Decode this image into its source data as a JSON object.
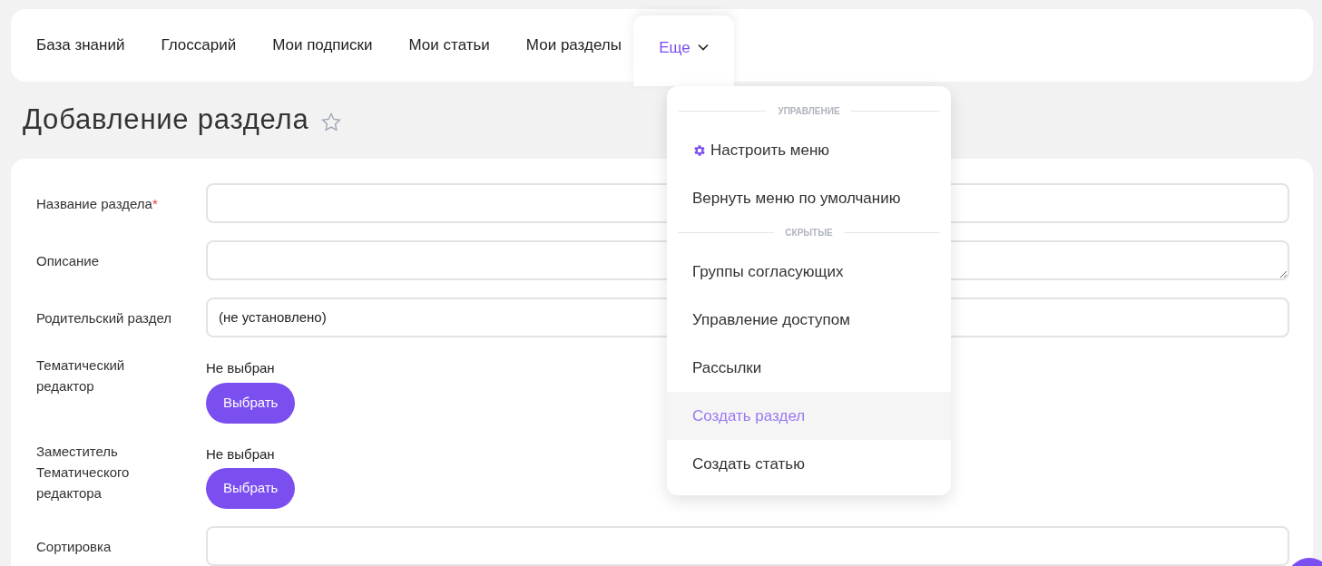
{
  "nav": {
    "items": [
      {
        "label": "База знаний",
        "selected": false
      },
      {
        "label": "Глоссарий",
        "selected": false
      },
      {
        "label": "Мои подписки",
        "selected": false
      },
      {
        "label": "Мои статьи",
        "selected": false
      },
      {
        "label": "Мои разделы",
        "selected": false
      }
    ],
    "more": {
      "label": "Еще",
      "expanded": true
    }
  },
  "menu": [
    {
      "heading": "УПРАВЛЕНИЕ",
      "items": [
        {
          "label": "Настроить меню",
          "kind": "settings",
          "selected": false
        },
        {
          "label": "Вернуть меню по умолчанию",
          "kind": "plain",
          "selected": false
        }
      ]
    },
    {
      "heading": "СКРЫТЫЕ",
      "items": [
        {
          "label": "Группы согласующих",
          "kind": "plain",
          "selected": false
        },
        {
          "label": "Управление доступом",
          "kind": "plain",
          "selected": false
        },
        {
          "label": "Рассылки",
          "kind": "plain",
          "selected": false
        },
        {
          "label": "Создать раздел",
          "kind": "plain",
          "selected": true
        },
        {
          "label": "Создать статью",
          "kind": "plain",
          "selected": false
        }
      ]
    }
  ],
  "page_title": "Добавление раздела",
  "favorite": false,
  "form": [
    {
      "label": "Название раздела",
      "required_mark": "*",
      "kind": "input"
    },
    {
      "label": "Описание",
      "kind": "textarea"
    },
    {
      "label": "Родительский раздел",
      "kind": "select",
      "value": "(не установлено)"
    },
    {
      "label": "Тематический редактор",
      "kind": "picker",
      "status": "Не выбран",
      "button": "Выбрать"
    },
    {
      "label": "Заместитель Тематического редактора",
      "kind": "picker",
      "status": "Не выбран",
      "button": "Выбрать"
    },
    {
      "label": "Сортировка",
      "kind": "input"
    }
  ]
}
